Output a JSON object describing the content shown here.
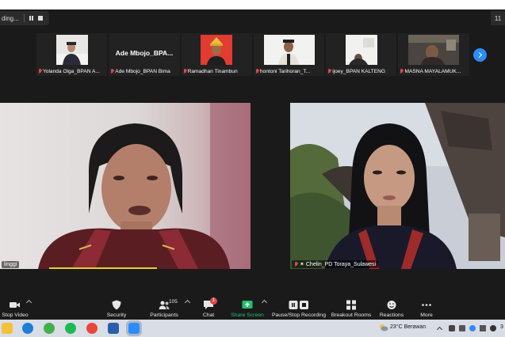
{
  "recording": {
    "label": "ding..."
  },
  "view_badge": "11",
  "thumbnails": [
    {
      "name": "Yolanda Olga_BPAN A...",
      "video": true
    },
    {
      "name": "Ade Mbojo_BPAN Bima",
      "video": false,
      "display_name": "Ade  Mbojo_BPA..."
    },
    {
      "name": "Ramadhan Tinambun",
      "video": true
    },
    {
      "name": "hontoni Tarihoran_T...",
      "video": true
    },
    {
      "name": "ijoey_BPAN KALTENG",
      "video": true
    },
    {
      "name": "MASNA MAYALAMUK...",
      "video": true
    }
  ],
  "main_videos": {
    "left": {
      "label": "linggi"
    },
    "right": {
      "label": "Chelin_PD Toraya_Sulawesi"
    }
  },
  "toolbar": {
    "stop_video": "Stop Video",
    "security": "Security",
    "participants": "Participants",
    "participants_count": "105",
    "chat": "Chat",
    "chat_badge": "1",
    "share_screen": "Share Screen",
    "pause_stop_recording": "Pause/Stop Recording",
    "breakout_rooms": "Breakout Rooms",
    "reactions": "Reactions",
    "more": "More"
  },
  "taskbar": {
    "weather": "23°C  Berawan",
    "clock_fragment": "3"
  },
  "colors": {
    "share_green": "#23c16b",
    "accent_blue": "#2d8cff",
    "mute_red": "#e04848",
    "speaker_yellow": "#e8d020"
  }
}
